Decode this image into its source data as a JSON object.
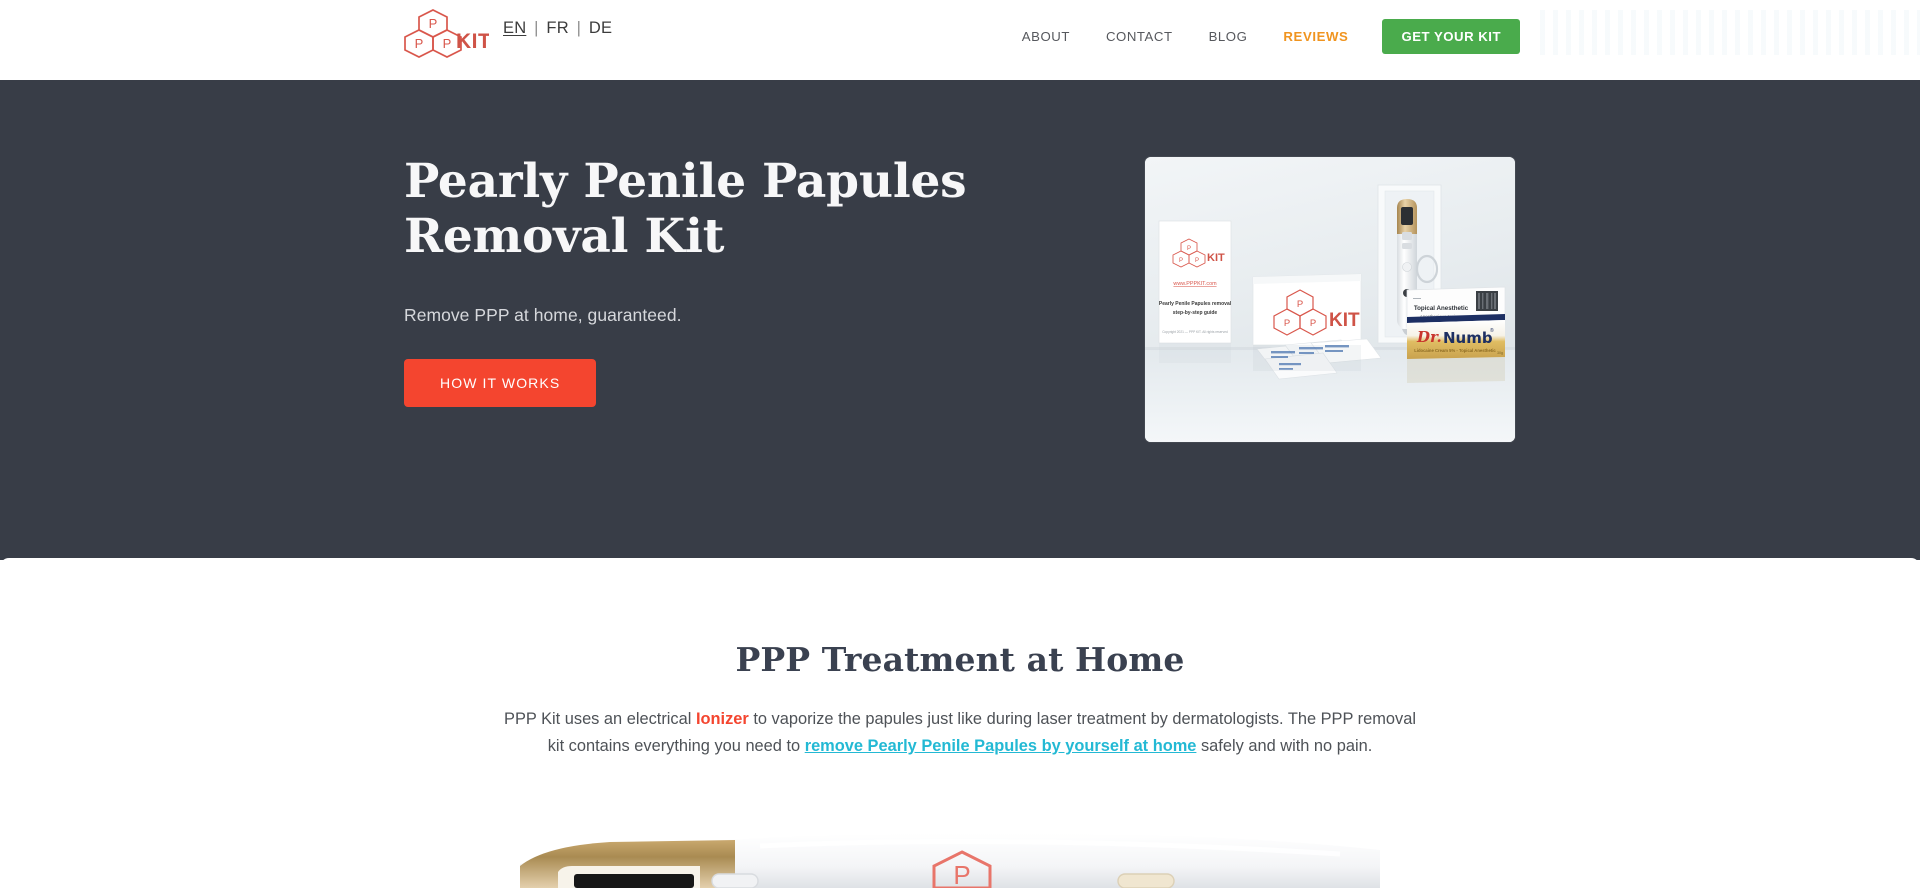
{
  "header": {
    "logo_text": "KIT",
    "logo_name": "ppp-kit-logo",
    "languages": [
      {
        "code": "EN",
        "active": true
      },
      {
        "code": "FR",
        "active": false
      },
      {
        "code": "DE",
        "active": false
      }
    ],
    "separator": "|",
    "nav": [
      {
        "label": "ABOUT",
        "accent": false
      },
      {
        "label": "CONTACT",
        "accent": false
      },
      {
        "label": "BLOG",
        "accent": false
      },
      {
        "label": "REVIEWS",
        "accent": true
      }
    ],
    "cta_label": "GET YOUR KIT",
    "cta_color": "#4aab4c",
    "accent_color": "#f0941f"
  },
  "hero": {
    "title_line1": "Pearly Penile Papules",
    "title_line2": "Removal Kit",
    "subtitle": "Remove PPP at home, guaranteed.",
    "button_label": "HOW IT WORKS",
    "button_color": "#f4452f",
    "background_color": "#383d47",
    "image": {
      "alt": "PPP Kit product photo: guide booklet, branded box, ionizer pen in tray, Topical Anesthetic box, Dr. Numb cream and alcohol wipes",
      "guide_title_line1": "Pearly Penile Papules removal",
      "guide_title_line2": "step-by-step guide",
      "guide_url": "www.PPPKIT.com",
      "box_text": "KIT",
      "anesthetic_label_line1": "Topical Anesthetic",
      "anesthetic_label_line2": "Anesthesique topique",
      "cream_brand": "Dr. Numb"
    }
  },
  "main": {
    "section_title": "PPP Treatment at Home",
    "paragraph": {
      "part1": "PPP Kit uses an electrical ",
      "highlight1": "Ionizer",
      "part2": " to vaporize the papules just like during laser treatment by dermatologists. The PPP removal kit contains everything you need to ",
      "highlight2": "remove Pearly Penile Papules by yourself at home",
      "part3": " safely and with no pain."
    },
    "highlight1_color": "#f4452f",
    "highlight2_color": "#23b9d4",
    "device_image_alt": "Close-up of the gold and white ionizer device with PPP logo"
  }
}
